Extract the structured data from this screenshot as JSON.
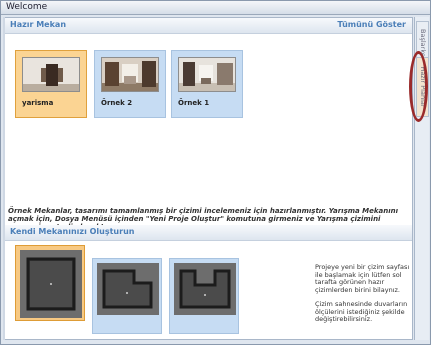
{
  "window": {
    "title": "Welcome"
  },
  "ready_spaces": {
    "header": "Hazır Mekan",
    "show_all": "Tümünü Göster",
    "items": [
      {
        "label": "yarisma",
        "selected": true
      },
      {
        "label": "Örnek 2",
        "selected": false
      },
      {
        "label": "Örnek 1",
        "selected": false
      }
    ],
    "note": "Örnek Mekanlar, tasarımı tamamlanmış bir çizimi incelemeniz için hazırlanmıştır. Yarışma Mekanını açmak için, Dosya Menüsü içinden \"Yeni Proje Oluştur\" komutuna girmeniz ve Yarışma çizimini seçmeniz yeterli olacaktır."
  },
  "create_space": {
    "header": "Kendi Mekanınızı Oluşturun",
    "plans": [
      {
        "shape": "square",
        "selected": true
      },
      {
        "shape": "L-shape",
        "selected": false
      },
      {
        "shape": "U-shape",
        "selected": false
      }
    ],
    "help_1": "Projeye yeni bir çizim sayfası ile başlamak için lütfen sol tarafta görünen hazır çizimlerden birini bilaynız.",
    "help_2": "Çizim sahnesinde duvarların ölçülerini istediğiniz şekilde değiştirebilirsiniz."
  },
  "sidebar": {
    "tabs": [
      {
        "label": "Başlarken",
        "active": false
      },
      {
        "label": "Hazır Planlar",
        "active": true
      }
    ]
  },
  "colors": {
    "accent_text": "#4b7fb8",
    "card_bg": "#c6dcf3",
    "card_selected": "#fbd493",
    "annotation_circle": "#9a2b2b"
  }
}
